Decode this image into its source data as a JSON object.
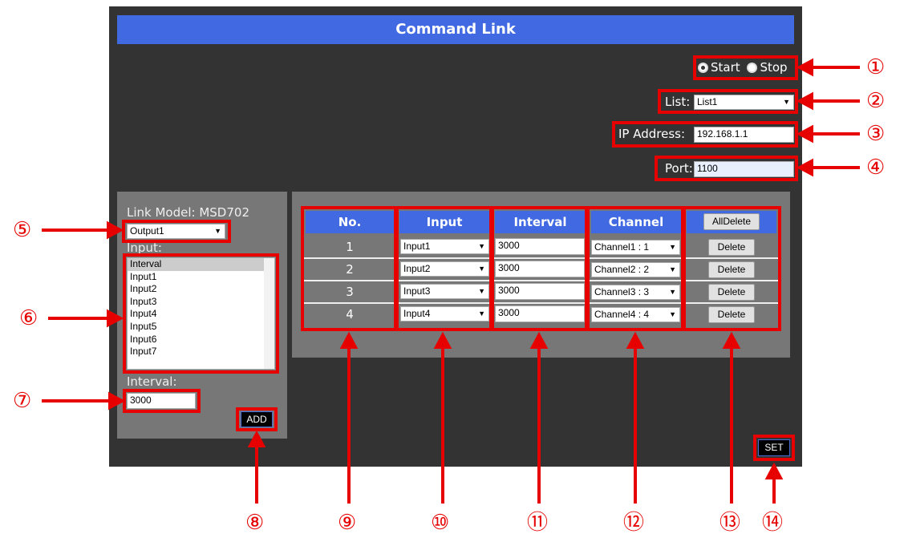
{
  "title": "Command Link",
  "run_mode": {
    "start_label": "Start",
    "stop_label": "Stop",
    "selected": "Start"
  },
  "list": {
    "label": "List:",
    "value": "List1"
  },
  "ip": {
    "label": "IP Address:",
    "value": "192.168.1.1"
  },
  "port": {
    "label": "Port:",
    "value": "1100"
  },
  "left": {
    "model_label": "Link Model: MSD702",
    "output_value": "Output1",
    "input_label": "Input:",
    "input_items": [
      "Interval",
      "Input1",
      "Input2",
      "Input3",
      "Input4",
      "Input5",
      "Input6",
      "Input7"
    ],
    "interval_label": "Interval:",
    "interval_value": "3000",
    "add_label": "ADD"
  },
  "table": {
    "headers": {
      "no": "No.",
      "input": "Input",
      "interval": "Interval",
      "channel": "Channel"
    },
    "alldelete_label": "AllDelete",
    "delete_label": "Delete",
    "rows": [
      {
        "no": "1",
        "input": "Input1",
        "interval": "3000",
        "channel": "Channel1 : 1"
      },
      {
        "no": "2",
        "input": "Input2",
        "interval": "3000",
        "channel": "Channel2 : 2"
      },
      {
        "no": "3",
        "input": "Input3",
        "interval": "3000",
        "channel": "Channel3 : 3"
      },
      {
        "no": "4",
        "input": "Input4",
        "interval": "3000",
        "channel": "Channel4 : 4"
      }
    ]
  },
  "set_label": "SET",
  "callouts": [
    "①",
    "②",
    "③",
    "④",
    "⑤",
    "⑥",
    "⑦",
    "⑧",
    "⑨",
    "⑩",
    "⑪",
    "⑫",
    "⑬",
    "⑭"
  ],
  "colors": {
    "title_bar": "#4169e1",
    "annotation": "#e60000",
    "panel_bg": "#333333"
  }
}
